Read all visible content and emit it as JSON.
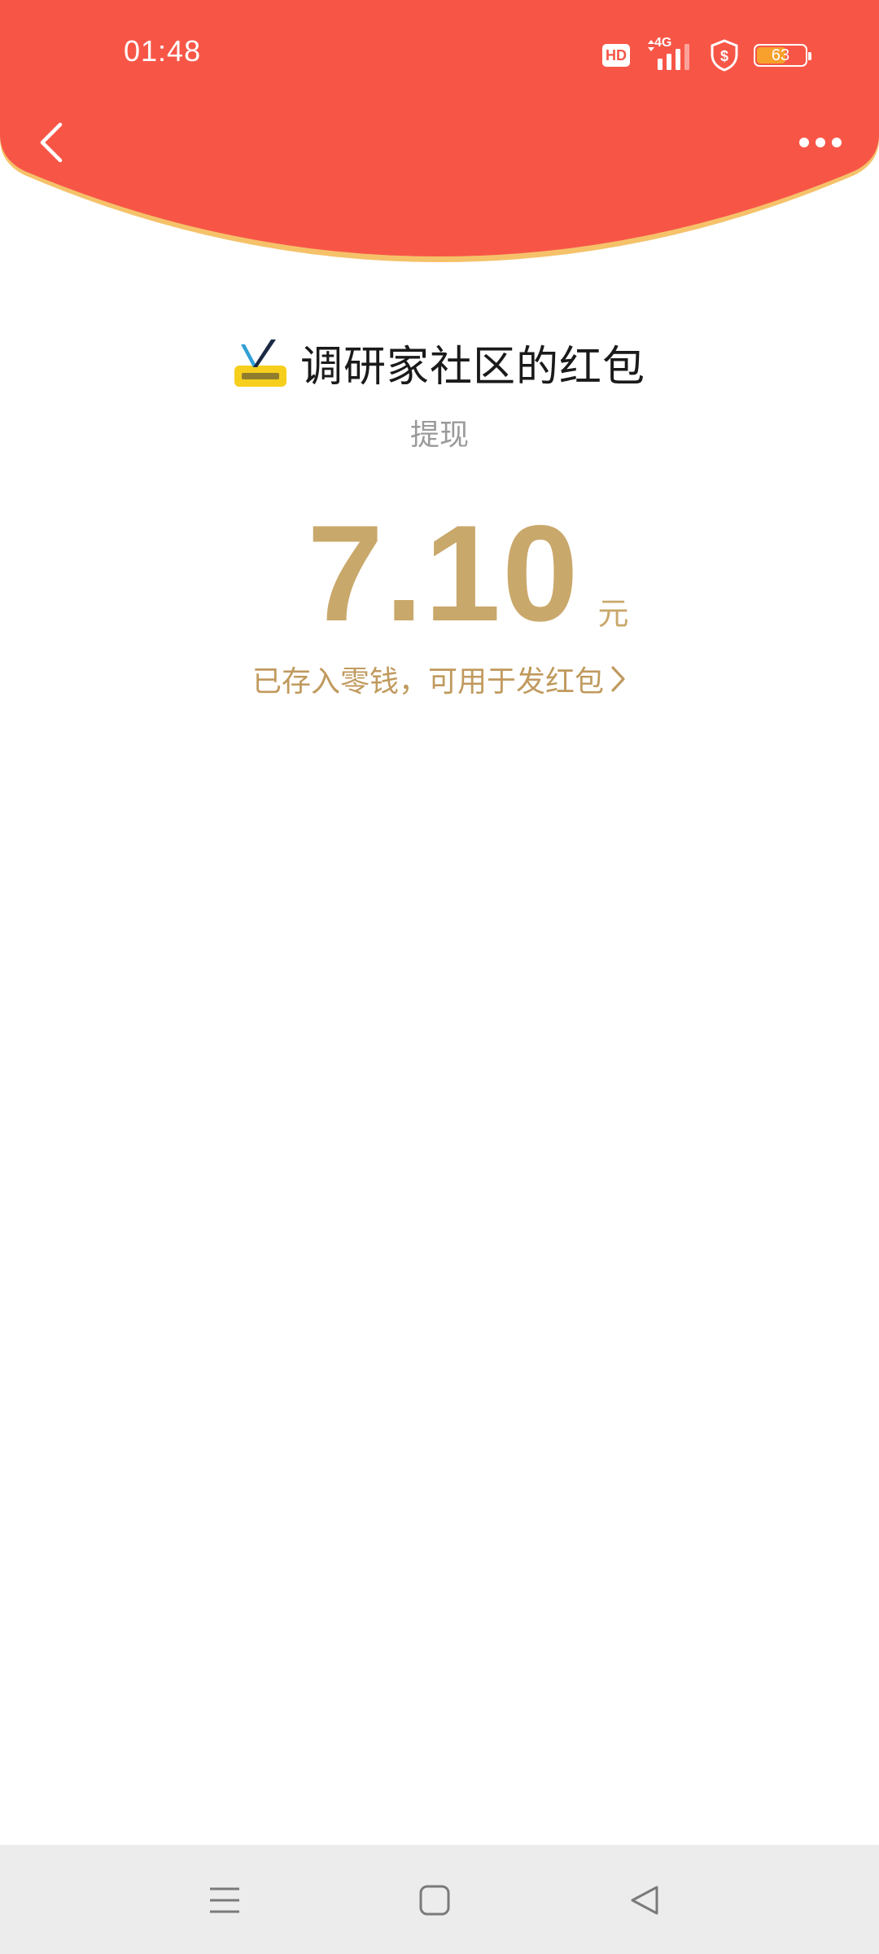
{
  "status_bar": {
    "time": "01:48",
    "hd_label": "HD",
    "network": "4G",
    "battery": "63",
    "battery_level": 0.63
  },
  "envelope": {
    "sender_title": "调研家社区的红包",
    "subtitle": "提现",
    "amount": "7.10",
    "unit": "元",
    "note": "已存入零钱，可用于发红包"
  },
  "colors": {
    "header_red": "#f75647",
    "header_rim": "#f5c26a",
    "gold": "#c9a86b",
    "title": "#1a1a1a",
    "subtitle": "#9a9a9a",
    "nav_bar": "#ececec"
  },
  "icons": {
    "back": "chevron-left-icon",
    "more": "more-dots-icon",
    "note_arrow": "chevron-right-icon",
    "nav_menu": "menu-lines-icon",
    "nav_home": "rounded-square-icon",
    "nav_back": "triangle-back-icon"
  }
}
